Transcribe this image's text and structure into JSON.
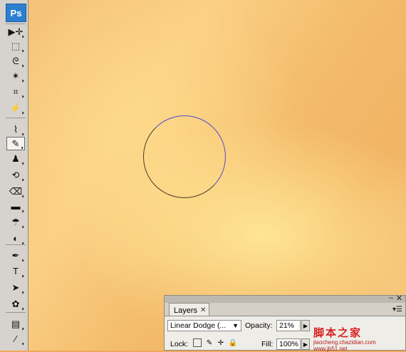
{
  "app": {
    "logo": "Ps"
  },
  "toolbox": {
    "tools": [
      {
        "name": "move-tool-icon",
        "glyph": "▶✛"
      },
      {
        "name": "marquee-tool-icon",
        "glyph": "⬚"
      },
      {
        "name": "lasso-tool-icon",
        "glyph": "ᘓ"
      },
      {
        "name": "magic-wand-tool-icon",
        "glyph": "✶"
      },
      {
        "name": "crop-tool-icon",
        "glyph": "⌗"
      },
      {
        "name": "slice-tool-icon",
        "glyph": "⚡"
      },
      {
        "name": "healing-brush-tool-icon",
        "glyph": "⌇"
      },
      {
        "name": "brush-tool-icon",
        "glyph": "✎"
      },
      {
        "name": "clone-stamp-tool-icon",
        "glyph": "♟"
      },
      {
        "name": "history-brush-tool-icon",
        "glyph": "⟲"
      },
      {
        "name": "eraser-tool-icon",
        "glyph": "⌫"
      },
      {
        "name": "gradient-tool-icon",
        "glyph": "▬"
      },
      {
        "name": "blur-tool-icon",
        "glyph": "☂"
      },
      {
        "name": "dodge-tool-icon",
        "glyph": "◐"
      },
      {
        "name": "pen-tool-icon",
        "glyph": "✒"
      },
      {
        "name": "type-tool-icon",
        "glyph": "T"
      },
      {
        "name": "path-selection-tool-icon",
        "glyph": "➤"
      },
      {
        "name": "shape-tool-icon",
        "glyph": "✿"
      },
      {
        "name": "notes-tool-icon",
        "glyph": "▤"
      },
      {
        "name": "eyedropper-tool-icon",
        "glyph": "⁄"
      }
    ]
  },
  "layers_panel": {
    "tab_label": "Layers",
    "blend_mode": "Linear Dodge (...",
    "opacity_label": "Opacity:",
    "opacity_value": "21%",
    "lock_label": "Lock:",
    "fill_label": "Fill:",
    "fill_value": "100%"
  },
  "watermark": {
    "text": "脚本之家",
    "url": "jiaocheng.chazidian.com www.jb51.net"
  }
}
